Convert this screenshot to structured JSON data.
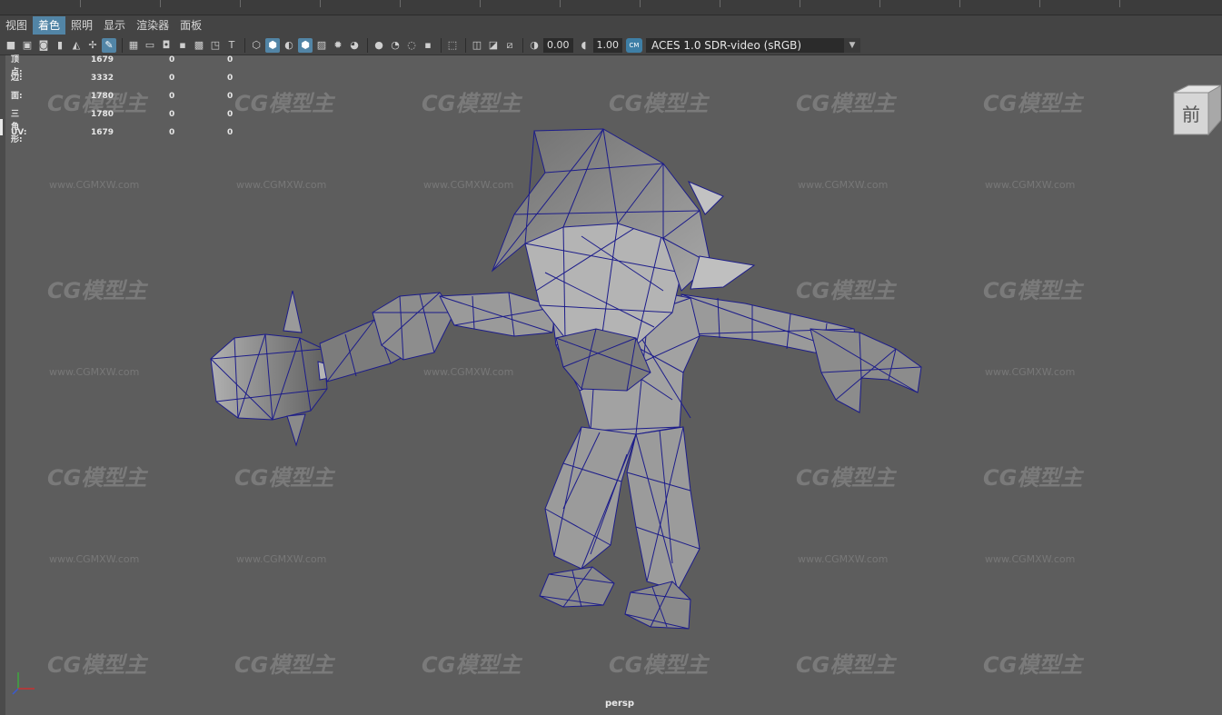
{
  "menubar": {
    "items": [
      {
        "label": "视图",
        "active": false
      },
      {
        "label": "着色",
        "active": true
      },
      {
        "label": "照明",
        "active": false
      },
      {
        "label": "显示",
        "active": false
      },
      {
        "label": "渲染器",
        "active": false
      },
      {
        "label": "面板",
        "active": false
      }
    ]
  },
  "toolbar": {
    "exposure_value": "0.00",
    "gamma_value": "1.00",
    "colorspace_badge": "CM",
    "colorspace_selected": "ACES 1.0 SDR-video (sRGB)"
  },
  "hud": {
    "rows": [
      {
        "label": "顶点:",
        "v1": "1679",
        "v2": "0",
        "v3": "0"
      },
      {
        "label": "边:",
        "v1": "3332",
        "v2": "0",
        "v3": "0"
      },
      {
        "label": "面:",
        "v1": "1780",
        "v2": "0",
        "v3": "0"
      },
      {
        "label": "三角形:",
        "v1": "1780",
        "v2": "0",
        "v3": "0"
      },
      {
        "label": "UV:",
        "v1": "1679",
        "v2": "0",
        "v3": "0"
      }
    ]
  },
  "viewcube": {
    "face_label": "前"
  },
  "camera_label": "persp",
  "watermark": {
    "brand": "CG模型主",
    "url": "www.CGMXW.com"
  },
  "colors": {
    "accent": "#5285a6",
    "viewport_bg": "#5d5d5d",
    "wire": "#1e1e8c",
    "mesh": "#8a8a8a"
  }
}
